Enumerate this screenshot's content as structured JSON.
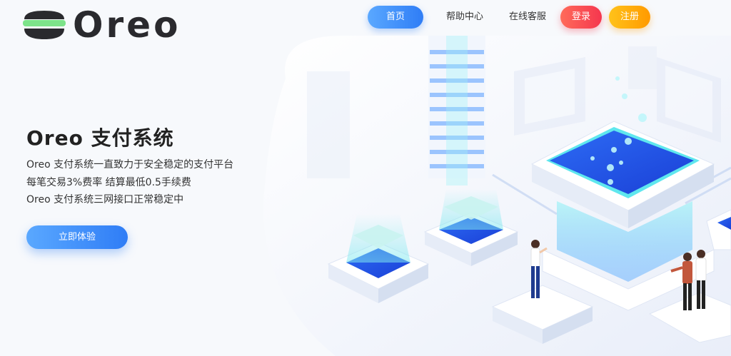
{
  "brand": {
    "name": "Oreo",
    "logo_icon": "oreo-cookie-logo"
  },
  "nav": {
    "home": "首页",
    "help": "帮助中心",
    "service": "在线客服",
    "login": "登录",
    "register": "注册"
  },
  "hero": {
    "title": "Oreo 支付系统",
    "lines": [
      "Oreo 支付系统一直致力于安全稳定的支付平台",
      "每笔交易3%费率 结算最低0.5手续费",
      "Oreo 支付系统三网接口正常稳定中"
    ],
    "cta": "立即体验"
  },
  "colors": {
    "primary": "#2f7df6",
    "login": "#f5364e",
    "register": "#ff9a00",
    "logo_green": "#7de38a"
  }
}
